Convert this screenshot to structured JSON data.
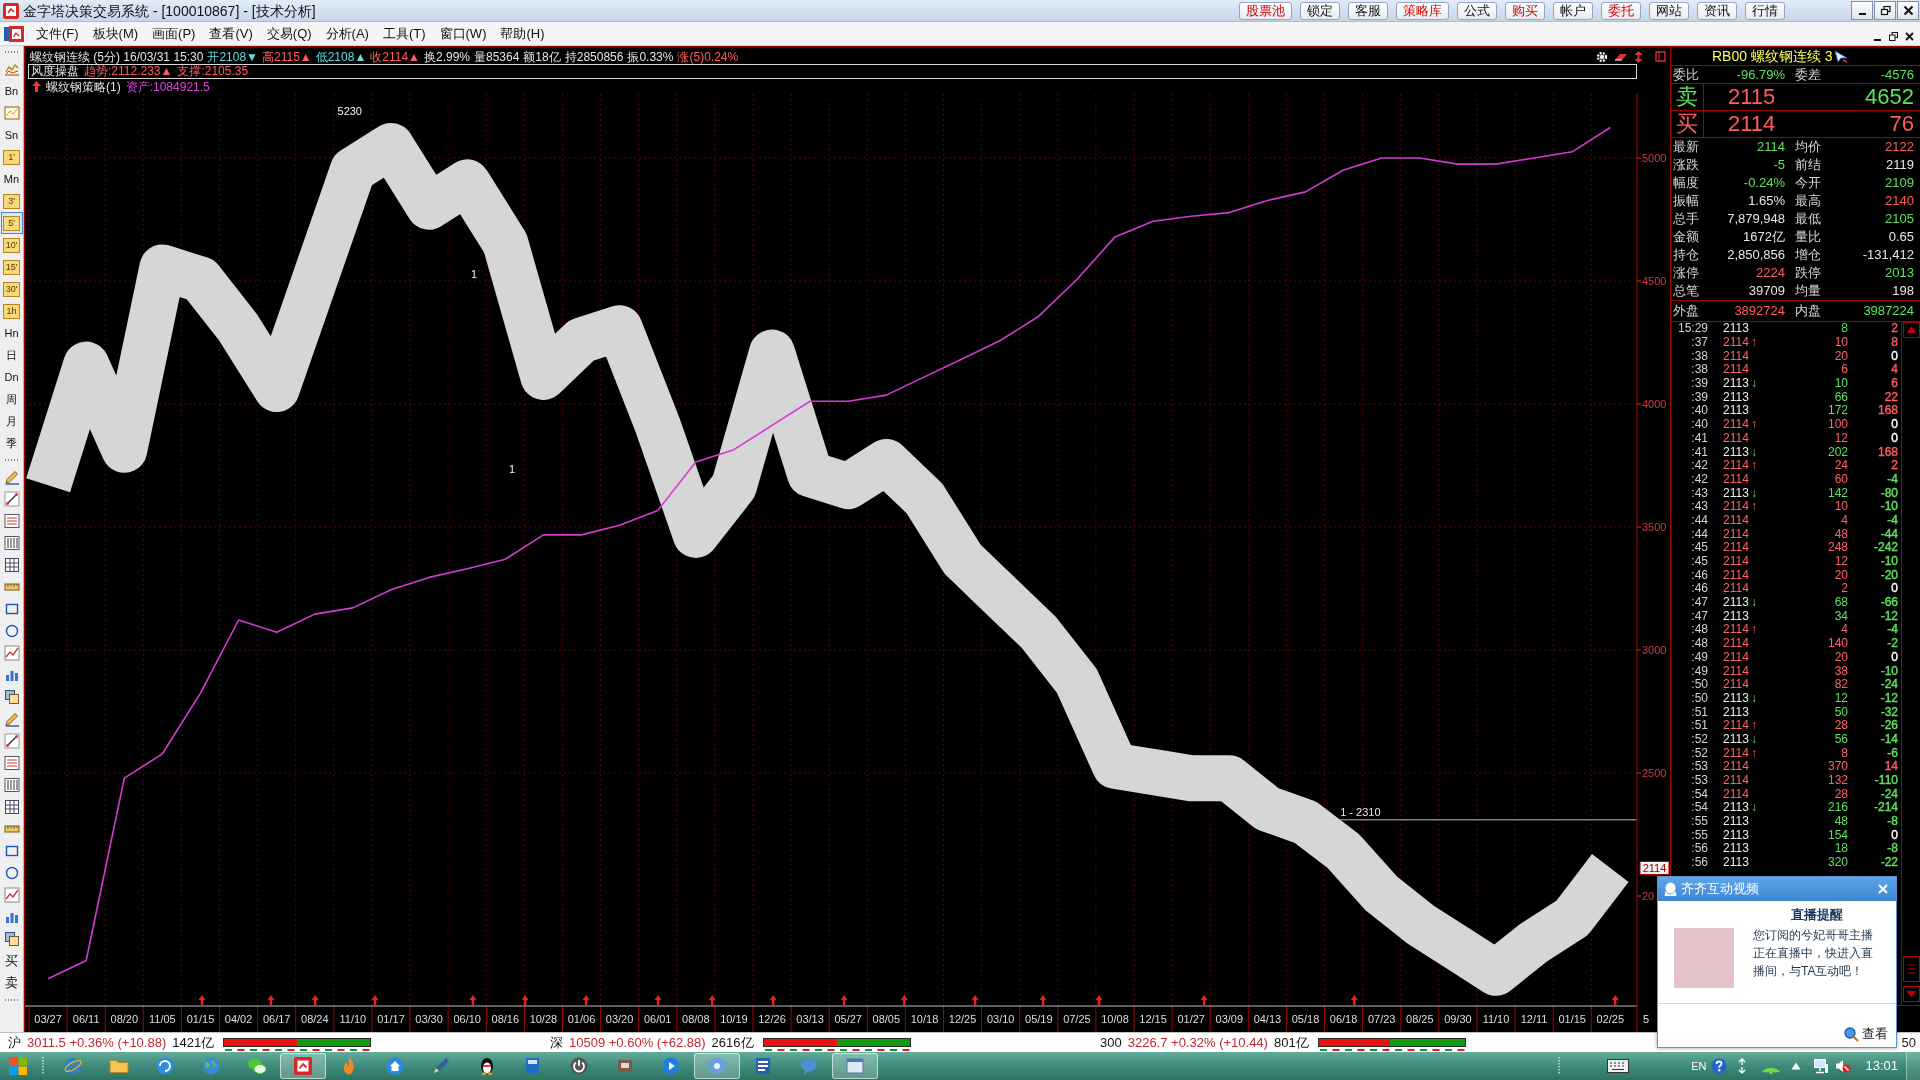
{
  "window": {
    "title": "金字塔决策交易系统 - [100010867] - [技术分析]",
    "toolbar_buttons": [
      {
        "label": "股票池",
        "highlight": true
      },
      {
        "label": "锁定",
        "highlight": false
      },
      {
        "label": "客服",
        "highlight": false
      },
      {
        "label": "策略库",
        "highlight": true
      },
      {
        "label": "公式",
        "highlight": false
      },
      {
        "label": "购买",
        "highlight": true
      },
      {
        "label": "帐户",
        "highlight": false
      },
      {
        "label": "委托",
        "highlight": true
      },
      {
        "label": "网站",
        "highlight": false
      },
      {
        "label": "资讯",
        "highlight": false
      },
      {
        "label": "行情",
        "highlight": false
      }
    ]
  },
  "menu": [
    "文件(F)",
    "板块(M)",
    "画面(P)",
    "查看(V)",
    "交易(Q)",
    "分析(A)",
    "工具(T)",
    "窗口(W)",
    "帮助(H)"
  ],
  "left_toolbar": {
    "period_buttons": [
      {
        "label": "Bn",
        "kind": "plain",
        "selected": false
      },
      {
        "label": "Sn",
        "kind": "plain",
        "selected": false
      },
      {
        "label": "1'",
        "kind": "tile",
        "selected": false
      },
      {
        "label": "Mn",
        "kind": "plain",
        "selected": false
      },
      {
        "label": "3'",
        "kind": "tile",
        "selected": false
      },
      {
        "label": "5'",
        "kind": "tile",
        "selected": true
      },
      {
        "label": "10'",
        "kind": "tile",
        "selected": false
      },
      {
        "label": "15'",
        "kind": "tile",
        "selected": false
      },
      {
        "label": "30'",
        "kind": "tile",
        "selected": false
      },
      {
        "label": "1h",
        "kind": "tile",
        "selected": false
      },
      {
        "label": "Hn",
        "kind": "plain",
        "selected": false
      },
      {
        "label": "日",
        "kind": "plain",
        "selected": false
      },
      {
        "label": "Dn",
        "kind": "plain",
        "selected": false
      },
      {
        "label": "周",
        "kind": "plain",
        "selected": false
      },
      {
        "label": "月",
        "kind": "plain",
        "selected": false
      },
      {
        "label": "季",
        "kind": "plain",
        "selected": false
      }
    ],
    "trade_buttons": [
      "买",
      "卖"
    ]
  },
  "chart": {
    "header": [
      {
        "text": "螺纹钢连续 (5分) 16/03/31 15:30",
        "color": "#e6e6e6"
      },
      {
        "text": "开2108▼",
        "color": "#5fe0e0"
      },
      {
        "text": "高2115▲",
        "color": "#ff5c5c"
      },
      {
        "text": "低2108▲",
        "color": "#5fe0e0"
      },
      {
        "text": "收2114▲",
        "color": "#ff5c5c"
      },
      {
        "text": "换2.99%",
        "color": "#e6e6e6"
      },
      {
        "text": "量85364",
        "color": "#e6e6e6"
      },
      {
        "text": "额18亿",
        "color": "#e6e6e6"
      },
      {
        "text": "持2850856",
        "color": "#e6e6e6"
      },
      {
        "text": "振0.33%",
        "color": "#e6e6e6"
      },
      {
        "text": "涨(5)0.24%",
        "color": "#ff5c5c"
      }
    ],
    "indicator": [
      {
        "text": "风度操盘",
        "color": "#e6e6e6"
      },
      {
        "text": "趋势:2112.233▲",
        "color": "#ff5c5c"
      },
      {
        "text": "支撑:2105.35",
        "color": "#ff5c5c"
      }
    ],
    "strategy": {
      "name": "螺纹钢策略(1)",
      "asset": "资产:1084921.5"
    },
    "price_tag": "2114",
    "corner_label": "5",
    "cut_tick_label": "20",
    "level_label": "1 - 2310",
    "chart_data": {
      "type": "line",
      "categories": [
        "03/27",
        "06/11",
        "08/20",
        "11/05",
        "01/15",
        "04/02",
        "06/17",
        "08/24",
        "11/10",
        "01/17",
        "03/30",
        "06/10",
        "08/16",
        "10/28",
        "01/06",
        "03/20",
        "06/01",
        "08/08",
        "10/19",
        "12/26",
        "03/13",
        "05/27",
        "08/05",
        "10/18",
        "12/25",
        "03/10",
        "05/19",
        "07/25",
        "10/08",
        "12/15",
        "01/27",
        "03/09",
        "04/13",
        "05/18",
        "06/18",
        "07/23",
        "08/25",
        "09/30",
        "11/10",
        "12/11",
        "01/15",
        "02/25"
      ],
      "series": [
        {
          "color": "#d6d6d6",
          "values": [
            3670,
            4160,
            3814,
            4555,
            4506,
            4308,
            4061,
            4506,
            4951,
            5049,
            4802,
            4901,
            4654,
            4110,
            4259,
            4308,
            3913,
            3468,
            3666,
            4209,
            3715,
            3666,
            3764,
            3616,
            3369,
            3220,
            3072,
            2874,
            2529,
            2504,
            2479,
            2479,
            2355,
            2300,
            2182,
            2009,
            1886,
            1787,
            1688,
            1812,
            1911,
            2114
          ]
        },
        {
          "color": "#d23cd2",
          "values": [
            1664,
            1738,
            2479,
            2578,
            2825,
            3122,
            3072,
            3146,
            3171,
            3245,
            3295,
            3330,
            3369,
            3468,
            3468,
            3507,
            3567,
            3764,
            3814,
            3913,
            4011,
            4011,
            4036,
            4110,
            4184,
            4259,
            4357,
            4506,
            4679,
            4743,
            4763,
            4778,
            4827,
            4862,
            4951,
            5000,
            5000,
            4975,
            4975,
            5000,
            5025,
            5124
          ]
        }
      ],
      "ylim": [
        1553,
        5260
      ],
      "yticks": [
        5000,
        4500,
        4000,
        3500,
        3000,
        2500
      ],
      "grid": true,
      "annotations": [
        "5230",
        "1",
        "1"
      ]
    }
  },
  "quote_panel": {
    "header": "RB00 螺纹钢连续 3",
    "ratio": [
      {
        "label": "委比",
        "value": "-96.79%",
        "color": "#5fe35f"
      },
      {
        "label": "委差",
        "value": "-4576",
        "color": "#5fe35f"
      }
    ],
    "book": [
      {
        "label": {
          "text": "卖",
          "color": "#5fe35f"
        },
        "price": {
          "text": "2115",
          "color": "#ff5c5c"
        },
        "volume": {
          "text": "4652",
          "color": "#5fe35f"
        }
      },
      {
        "label": {
          "text": "买",
          "color": "#ff5c5c"
        },
        "price": {
          "text": "2114",
          "color": "#ff5c5c"
        },
        "volume": {
          "text": "76",
          "color": "#ff5c5c"
        }
      }
    ],
    "stats": [
      {
        "label": "最新",
        "value": "2114",
        "color": "#5fe35f"
      },
      {
        "label": "均价",
        "value": "2122",
        "color": "#ff5c5c"
      },
      {
        "label": "涨跌",
        "value": "-5",
        "color": "#5fe35f"
      },
      {
        "label": "前结",
        "value": "2119",
        "color": "#e6e6e6"
      },
      {
        "label": "幅度",
        "value": "-0.24%",
        "color": "#5fe35f"
      },
      {
        "label": "今开",
        "value": "2109",
        "color": "#5fe35f"
      },
      {
        "label": "振幅",
        "value": "1.65%",
        "color": "#e6e6e6"
      },
      {
        "label": "最高",
        "value": "2140",
        "color": "#ff5c5c"
      },
      {
        "label": "总手",
        "value": "7,879,948",
        "color": "#e6e6e6"
      },
      {
        "label": "最低",
        "value": "2105",
        "color": "#5fe35f"
      },
      {
        "label": "金额",
        "value": "1672亿",
        "color": "#e6e6e6"
      },
      {
        "label": "量比",
        "value": "0.65",
        "color": "#e6e6e6"
      },
      {
        "label": "持仓",
        "value": "2,850,856",
        "color": "#e6e6e6"
      },
      {
        "label": "增仓",
        "value": "-131,412",
        "color": "#e6e6e6"
      },
      {
        "label": "涨停",
        "value": "2224",
        "color": "#ff5c5c"
      },
      {
        "label": "跌停",
        "value": "2013",
        "color": "#5fe35f"
      },
      {
        "label": "总笔",
        "value": "39709",
        "color": "#e6e6e6"
      },
      {
        "label": "均量",
        "value": "198",
        "color": "#e6e6e6"
      }
    ],
    "flow": [
      {
        "label": "外盘",
        "value": "3892724",
        "color": "#ff5c5c"
      },
      {
        "label": "内盘",
        "value": "3987224",
        "color": "#5fe35f"
      }
    ],
    "ticks": [
      {
        "time": "15:29",
        "price": "2113",
        "volume": "8",
        "change": {
          "text": "2",
          "color": "#ff5c5c"
        },
        "buy": false
      },
      {
        "time": ":37",
        "price": "2114",
        "arrow": "↑",
        "volume": "10",
        "change": {
          "text": "8",
          "color": "#ff5c5c"
        },
        "buy": true
      },
      {
        "time": ":38",
        "price": "2114",
        "volume": "20",
        "change": {
          "text": "0",
          "color": "#ffffff"
        },
        "buy": true
      },
      {
        "time": ":38",
        "price": "2114",
        "volume": "6",
        "change": {
          "text": "4",
          "color": "#ff5c5c"
        },
        "buy": true
      },
      {
        "time": ":39",
        "price": "2113",
        "arrow": "↓",
        "volume": "10",
        "change": {
          "text": "6",
          "color": "#ff5c5c"
        },
        "buy": false
      },
      {
        "time": ":39",
        "price": "2113",
        "volume": "66",
        "change": {
          "text": "22",
          "color": "#ff5c5c"
        },
        "buy": false
      },
      {
        "time": ":40",
        "price": "2113",
        "volume": "172",
        "change": {
          "text": "168",
          "color": "#ff5c5c"
        },
        "buy": false
      },
      {
        "time": ":40",
        "price": "2114",
        "arrow": "↑",
        "volume": "100",
        "change": {
          "text": "0",
          "color": "#ffffff"
        },
        "buy": true
      },
      {
        "time": ":41",
        "price": "2114",
        "volume": "12",
        "change": {
          "text": "0",
          "color": "#ffffff"
        },
        "buy": true
      },
      {
        "time": ":41",
        "price": "2113",
        "arrow": "↓",
        "volume": "202",
        "change": {
          "text": "168",
          "color": "#ff5c5c"
        },
        "buy": false
      },
      {
        "time": ":42",
        "price": "2114",
        "arrow": "↑",
        "volume": "24",
        "change": {
          "text": "2",
          "color": "#ff5c5c"
        },
        "buy": true
      },
      {
        "time": ":42",
        "price": "2114",
        "volume": "60",
        "change": {
          "text": "-4",
          "color": "#5fe35f"
        },
        "buy": true
      },
      {
        "time": ":43",
        "price": "2113",
        "arrow": "↓",
        "volume": "142",
        "change": {
          "text": "-80",
          "color": "#5fe35f"
        },
        "buy": false
      },
      {
        "time": ":43",
        "price": "2114",
        "arrow": "↑",
        "volume": "10",
        "change": {
          "text": "-10",
          "color": "#5fe35f"
        },
        "buy": true
      },
      {
        "time": ":44",
        "price": "2114",
        "volume": "4",
        "change": {
          "text": "-4",
          "color": "#5fe35f"
        },
        "buy": true
      },
      {
        "time": ":44",
        "price": "2114",
        "volume": "48",
        "change": {
          "text": "-44",
          "color": "#5fe35f"
        },
        "buy": true
      },
      {
        "time": ":45",
        "price": "2114",
        "volume": "248",
        "change": {
          "text": "-242",
          "color": "#5fe35f"
        },
        "buy": true
      },
      {
        "time": ":45",
        "price": "2114",
        "volume": "12",
        "change": {
          "text": "-10",
          "color": "#5fe35f"
        },
        "buy": true
      },
      {
        "time": ":46",
        "price": "2114",
        "volume": "20",
        "change": {
          "text": "-20",
          "color": "#5fe35f"
        },
        "buy": true
      },
      {
        "time": ":46",
        "price": "2114",
        "volume": "2",
        "change": {
          "text": "0",
          "color": "#ffffff"
        },
        "buy": true
      },
      {
        "time": ":47",
        "price": "2113",
        "arrow": "↓",
        "volume": "68",
        "change": {
          "text": "-66",
          "color": "#5fe35f"
        },
        "buy": false
      },
      {
        "time": ":47",
        "price": "2113",
        "volume": "34",
        "change": {
          "text": "-12",
          "color": "#5fe35f"
        },
        "buy": false
      },
      {
        "time": ":48",
        "price": "2114",
        "arrow": "↑",
        "volume": "4",
        "change": {
          "text": "-4",
          "color": "#5fe35f"
        },
        "buy": true
      },
      {
        "time": ":48",
        "price": "2114",
        "volume": "140",
        "change": {
          "text": "-2",
          "color": "#5fe35f"
        },
        "buy": true
      },
      {
        "time": ":49",
        "price": "2114",
        "volume": "20",
        "change": {
          "text": "0",
          "color": "#ffffff"
        },
        "buy": true
      },
      {
        "time": ":49",
        "price": "2114",
        "volume": "38",
        "change": {
          "text": "-10",
          "color": "#5fe35f"
        },
        "buy": true
      },
      {
        "time": ":50",
        "price": "2114",
        "volume": "82",
        "change": {
          "text": "-24",
          "color": "#5fe35f"
        },
        "buy": true
      },
      {
        "time": ":50",
        "price": "2113",
        "arrow": "↓",
        "volume": "12",
        "change": {
          "text": "-12",
          "color": "#5fe35f"
        },
        "buy": false
      },
      {
        "time": ":51",
        "price": "2113",
        "volume": "50",
        "change": {
          "text": "-32",
          "color": "#5fe35f"
        },
        "buy": false
      },
      {
        "time": ":51",
        "price": "2114",
        "arrow": "↑",
        "volume": "28",
        "change": {
          "text": "-26",
          "color": "#5fe35f"
        },
        "buy": true
      },
      {
        "time": ":52",
        "price": "2113",
        "arrow": "↓",
        "volume": "56",
        "change": {
          "text": "-14",
          "color": "#5fe35f"
        },
        "buy": false
      },
      {
        "time": ":52",
        "price": "2114",
        "arrow": "↑",
        "volume": "8",
        "change": {
          "text": "-6",
          "color": "#5fe35f"
        },
        "buy": true
      },
      {
        "time": ":53",
        "price": "2114",
        "volume": "370",
        "change": {
          "text": "14",
          "color": "#ff5c5c"
        },
        "buy": true
      },
      {
        "time": ":53",
        "price": "2114",
        "volume": "132",
        "change": {
          "text": "-110",
          "color": "#5fe35f"
        },
        "buy": true
      },
      {
        "time": ":54",
        "price": "2114",
        "volume": "28",
        "change": {
          "text": "-24",
          "color": "#5fe35f"
        },
        "buy": true
      },
      {
        "time": ":54",
        "price": "2113",
        "arrow": "↓",
        "volume": "216",
        "change": {
          "text": "-214",
          "color": "#5fe35f"
        },
        "buy": false
      },
      {
        "time": ":55",
        "price": "2113",
        "volume": "48",
        "change": {
          "text": "-8",
          "color": "#5fe35f"
        },
        "buy": false
      },
      {
        "time": ":55",
        "price": "2113",
        "volume": "154",
        "change": {
          "text": "0",
          "color": "#ffffff"
        },
        "buy": false
      },
      {
        "time": ":56",
        "price": "2113",
        "volume": "18",
        "change": {
          "text": "-8",
          "color": "#5fe35f"
        },
        "buy": false
      },
      {
        "time": ":56",
        "price": "2113",
        "volume": "320",
        "change": {
          "text": "-22",
          "color": "#5fe35f"
        },
        "buy": false
      }
    ]
  },
  "popup": {
    "title": "齐齐互动视频",
    "heading": "直播提醒",
    "message": "您订阅的兮妃哥哥主播正在直播中，快进入直播间，与TA互动吧！",
    "link": "查看"
  },
  "status_bar": {
    "indices": [
      {
        "market": "沪",
        "quote": "3011.5 +0.36% (+10.88)",
        "amount": "1421亿",
        "level": 0.5
      },
      {
        "market": "深",
        "quote": "10509 +0.60% (+62.88)",
        "amount": "2616亿",
        "level": 0.5
      },
      {
        "market": "300",
        "quote": "3226.7 +0.32% (+10.44)",
        "amount": "801亿",
        "level": 0.49
      }
    ],
    "right_text": "50"
  },
  "taskbar": {
    "buttons": [
      {
        "selected": false
      },
      {
        "selected": false
      },
      {
        "selected": false
      },
      {
        "selected": false
      },
      {
        "selected": false
      },
      {
        "selected": true
      },
      {
        "selected": false
      },
      {
        "selected": false
      },
      {
        "selected": false
      },
      {
        "selected": false
      },
      {
        "selected": false
      },
      {
        "selected": false
      },
      {
        "selected": false
      },
      {
        "selected": false
      },
      {
        "selected": true
      },
      {
        "selected": false
      },
      {
        "selected": false
      },
      {
        "selected": true
      }
    ],
    "language": "EN",
    "clock": "13:01"
  }
}
